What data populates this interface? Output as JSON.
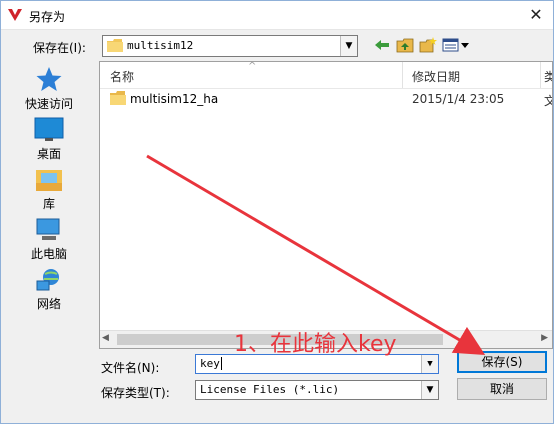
{
  "window": {
    "title": "另存为",
    "close_glyph": "✕"
  },
  "toolbar": {
    "look_in_label": "保存在(I):",
    "look_in_value": "multisim12",
    "icons": [
      "back-arrow-icon",
      "up-folder-icon",
      "new-folder-icon",
      "view-menu-icon"
    ]
  },
  "places": [
    {
      "label": "快速访问",
      "icon": "star-icon"
    },
    {
      "label": "桌面",
      "icon": "desktop-icon"
    },
    {
      "label": "库",
      "icon": "library-icon"
    },
    {
      "label": "此电脑",
      "icon": "computer-icon"
    },
    {
      "label": "网络",
      "icon": "network-icon"
    }
  ],
  "file_list": {
    "columns": {
      "name": "名称",
      "date": "修改日期",
      "extra": "类"
    },
    "rows": [
      {
        "name": "multisim12_ha",
        "date": "2015/1/4 23:05",
        "extra": "文"
      }
    ]
  },
  "form": {
    "file_name_label": "文件名(N):",
    "file_name_value": "key",
    "file_type_label": "保存类型(T):",
    "file_type_value": "License Files (*.lic)"
  },
  "buttons": {
    "save": "保存(S)",
    "cancel": "取消"
  },
  "annotation": {
    "text": "1、在此输入key",
    "color": "#e8343c"
  }
}
